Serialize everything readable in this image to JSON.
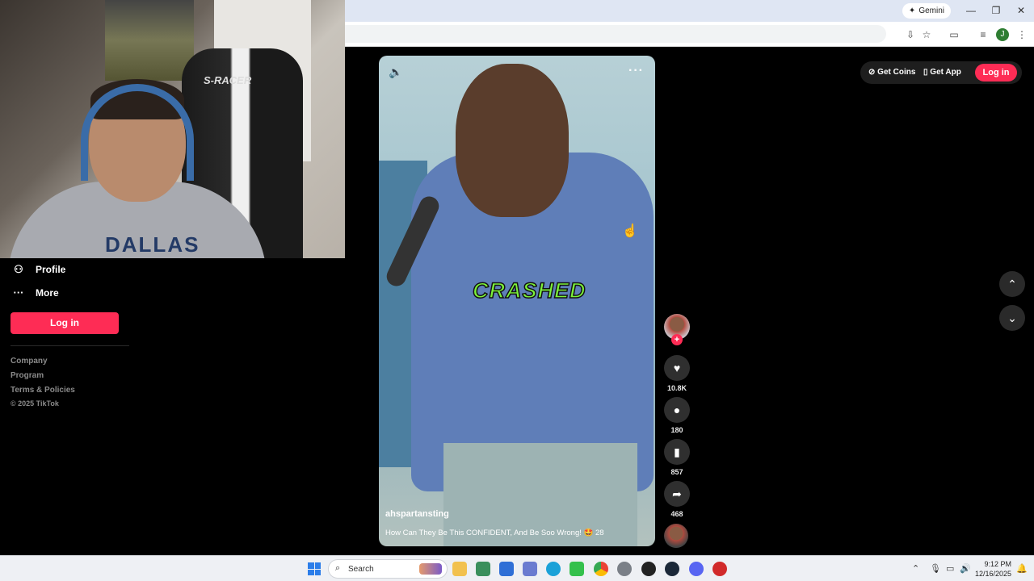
{
  "browser": {
    "gemini_label": "Gemini",
    "minimize": "—",
    "restore": "❐",
    "close": "✕",
    "profile_initial": "J"
  },
  "sidebar": {
    "items": [
      {
        "label": "Profile",
        "icon": "person-icon"
      },
      {
        "label": "More",
        "icon": "ellipsis-icon"
      }
    ],
    "login_label": "Log in",
    "footer_links": [
      "Company",
      "Program",
      "Terms & Policies"
    ],
    "copyright": "© 2025 TikTok"
  },
  "webcam": {
    "chair_brand": "S-RACER",
    "shirt_text": "DALLAS"
  },
  "video": {
    "caption": "CRASHED",
    "author": "ahspartansting",
    "description": "How Can They Be This CONFIDENT, And Be Soo Wrong! 🤩 28"
  },
  "actions": {
    "likes": "10.8K",
    "comments": "180",
    "bookmarks": "857",
    "shares": "468"
  },
  "header": {
    "get_coins": "Get Coins",
    "get_app": "Get App",
    "login": "Log in"
  },
  "taskbar": {
    "search_placeholder": "Search",
    "time": "9:12 PM",
    "date": "12/16/2025"
  },
  "colors": {
    "accent": "#fe2c55",
    "caption_green": "#7cf23a"
  }
}
